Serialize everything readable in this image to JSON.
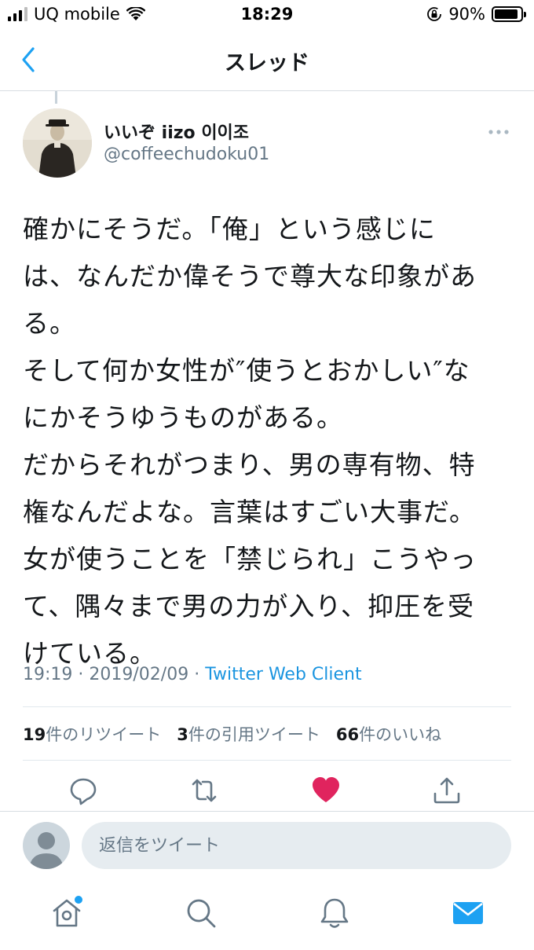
{
  "status_bar": {
    "carrier": "UQ mobile",
    "time": "18:29",
    "battery_percent": "90%",
    "battery_level": 0.9,
    "icons": [
      "signal-icon",
      "wifi-icon",
      "rotation-lock-icon",
      "battery-icon"
    ]
  },
  "nav": {
    "title": "スレッド",
    "back_icon": "chevron-left-icon"
  },
  "tweet": {
    "display_name": "いいぞ iizo 이이조",
    "handle": "@coffeechudoku01",
    "text_lines": [
      "確かにそうだ。「俺」という感じに",
      "は、なんだか偉そうで尊大な印象があ",
      "る。",
      "そして何か女性が″使うとおかしい″な",
      "にかそうゆうものがある。",
      "だからそれがつまり、男の専有物、特",
      "権なんだよな。言葉はすごい大事だ。",
      "女が使うことを「禁じられ」こうやっ",
      "て、隅々まで男の力が入り、抑圧を受",
      "けている。"
    ],
    "time": "19:19",
    "date": "2019/02/09",
    "separator": "·",
    "client": "Twitter Web Client",
    "stats": {
      "retweets_count": "19",
      "retweets_label": "件のリツイート",
      "quotes_count": "3",
      "quotes_label": "件の引用ツイート",
      "likes_count": "66",
      "likes_label": "件のいいね"
    },
    "liked": true
  },
  "actions": [
    "reply-icon",
    "retweet-icon",
    "heart-icon",
    "share-icon"
  ],
  "reply": {
    "placeholder": "返信をツイート"
  },
  "tabbar": {
    "items": [
      "home-icon",
      "search-icon",
      "notifications-icon",
      "messages-icon"
    ],
    "active": "messages-icon"
  },
  "colors": {
    "accent": "#1da1f2",
    "like": "#e0245e",
    "secondary_text": "#657786"
  }
}
